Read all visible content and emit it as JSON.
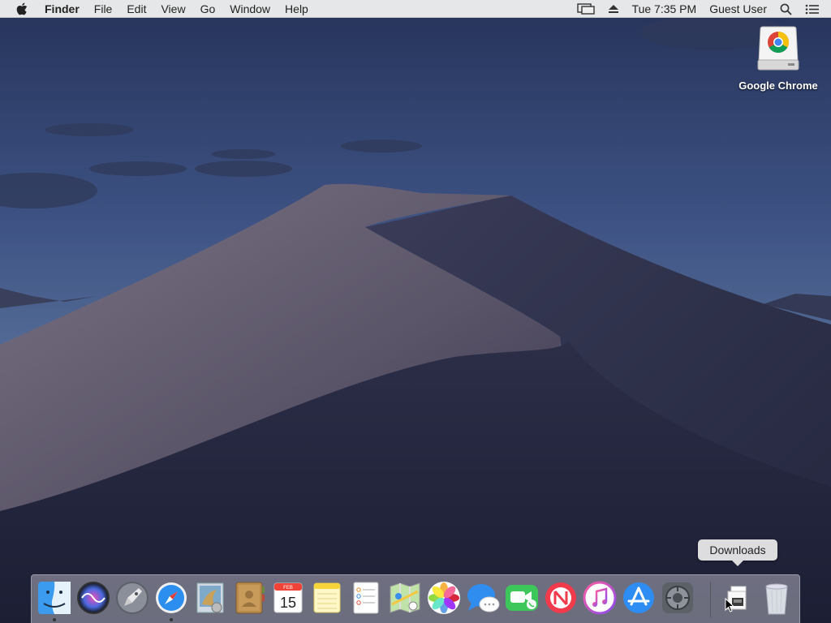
{
  "menubar": {
    "app_name": "Finder",
    "menus": [
      "File",
      "Edit",
      "View",
      "Go",
      "Window",
      "Help"
    ],
    "clock": "Tue 7:35 PM",
    "user": "Guest User",
    "icons": [
      "apple-icon",
      "display-mirroring-icon",
      "eject-icon",
      "spotlight-search-icon",
      "notification-center-icon"
    ]
  },
  "desktop": {
    "icon_label": "Google Chrome",
    "icon_type": "disk-image-icon"
  },
  "tooltip": {
    "text": "Downloads"
  },
  "dock": {
    "items": [
      {
        "icon": "finder-icon",
        "running": true
      },
      {
        "icon": "siri-icon",
        "running": false
      },
      {
        "icon": "launchpad-icon",
        "running": false
      },
      {
        "icon": "safari-icon",
        "running": true
      },
      {
        "icon": "mail-icon",
        "running": false
      },
      {
        "icon": "contacts-icon",
        "running": false
      },
      {
        "icon": "calendar-icon",
        "running": false,
        "month": "FEB",
        "day": "15"
      },
      {
        "icon": "notes-icon",
        "running": false
      },
      {
        "icon": "reminders-icon",
        "running": false
      },
      {
        "icon": "maps-icon",
        "running": false
      },
      {
        "icon": "photos-icon",
        "running": false
      },
      {
        "icon": "messages-icon",
        "running": false
      },
      {
        "icon": "facetime-icon",
        "running": false
      },
      {
        "icon": "news-icon",
        "running": false
      },
      {
        "icon": "itunes-icon",
        "running": false
      },
      {
        "icon": "app-store-icon",
        "running": false
      },
      {
        "icon": "system-preferences-icon",
        "running": false
      },
      {
        "icon": "downloads-stack-icon",
        "running": false
      },
      {
        "icon": "trash-icon",
        "running": false
      }
    ]
  },
  "colors": {
    "sky_top": "#2a3658",
    "sky_mid": "#4a5e8a",
    "dune_light": "#6e6878",
    "dune_dark": "#23263e",
    "menubar": "#eeeeee"
  }
}
